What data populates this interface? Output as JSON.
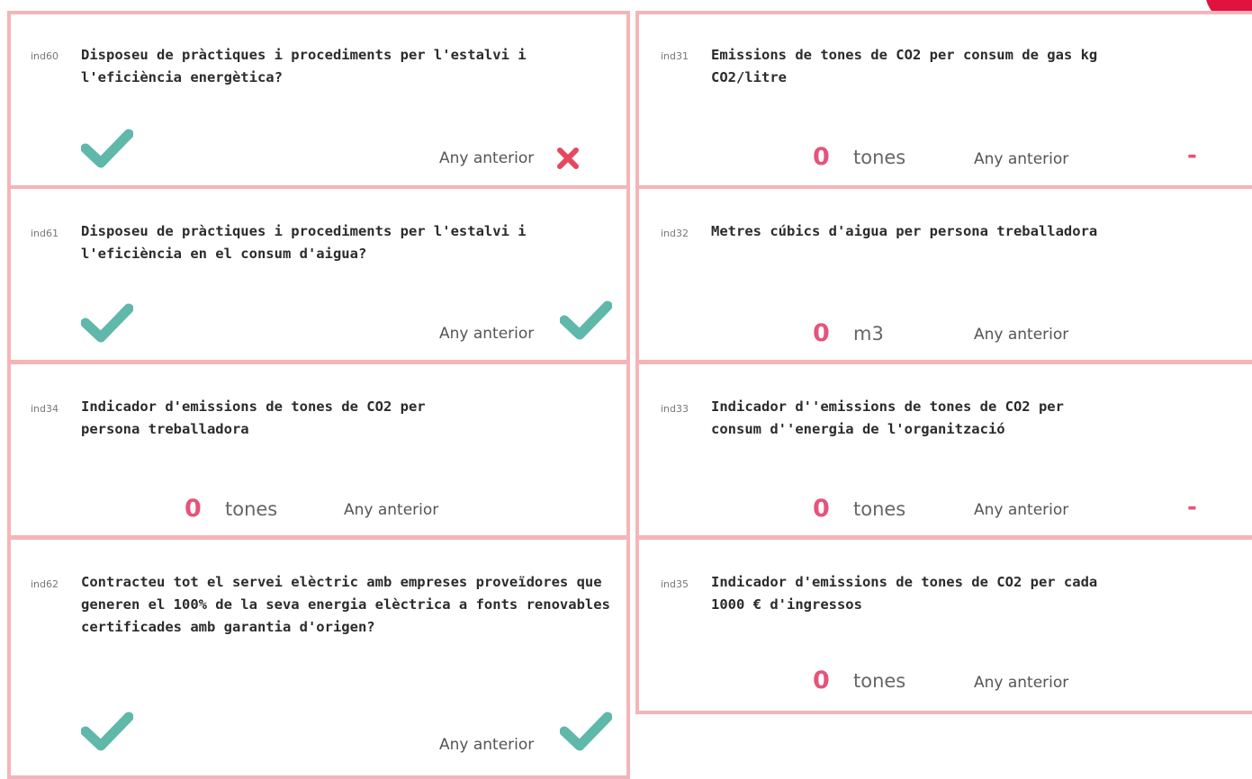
{
  "colors": {
    "border": "#f5b5b8",
    "accent": "#e5547a",
    "check": "#5fb8aa",
    "cross": "#e5485f"
  },
  "left": [
    {
      "code": "ind60",
      "question": "Disposeu de pràctiques i procediments per l'estalvi i l'eficiència energètica?",
      "current_icon": "check-icon",
      "prev_label": "Any anterior",
      "prev_icon": "cross-icon"
    },
    {
      "code": "ind61",
      "question": "Disposeu de pràctiques i procediments per l'estalvi i l'eficiència en el consum d'aigua?",
      "current_icon": "check-icon",
      "prev_label": "Any anterior",
      "prev_icon": "check-icon"
    },
    {
      "code": "ind34",
      "question": "Indicador d'emissions de tones de CO2 per persona treballadora",
      "value": "0",
      "unit": "tones",
      "prev_label": "Any anterior"
    },
    {
      "code": "ind62",
      "question": "Contracteu tot el servei elèctric amb empreses proveïdores que generen el 100% de la seva energia elèctrica a fonts renovables certificades amb garantia d'origen?",
      "current_icon": "check-icon",
      "prev_label": "Any anterior",
      "prev_icon": "check-icon"
    }
  ],
  "right": [
    {
      "code": "ind31",
      "question": "Emissions de tones de CO2 per consum de gas kg CO2/litre",
      "value": "0",
      "unit": "tones",
      "prev_label": "Any anterior",
      "prev_value": "-"
    },
    {
      "code": "ind32",
      "question": "Metres cúbics d'aigua per persona treballadora",
      "value": "0",
      "unit": "m3",
      "prev_label": "Any anterior"
    },
    {
      "code": "ind33",
      "question": "Indicador d''emissions de tones de CO2 per consum d''energia de l'organització",
      "value": "0",
      "unit": "tones",
      "prev_label": "Any anterior",
      "prev_value": "-"
    },
    {
      "code": "ind35",
      "question": "Indicador d'emissions de tones de CO2 per cada 1000 € d'ingressos",
      "value": "0",
      "unit": "tones",
      "prev_label": "Any anterior"
    }
  ]
}
